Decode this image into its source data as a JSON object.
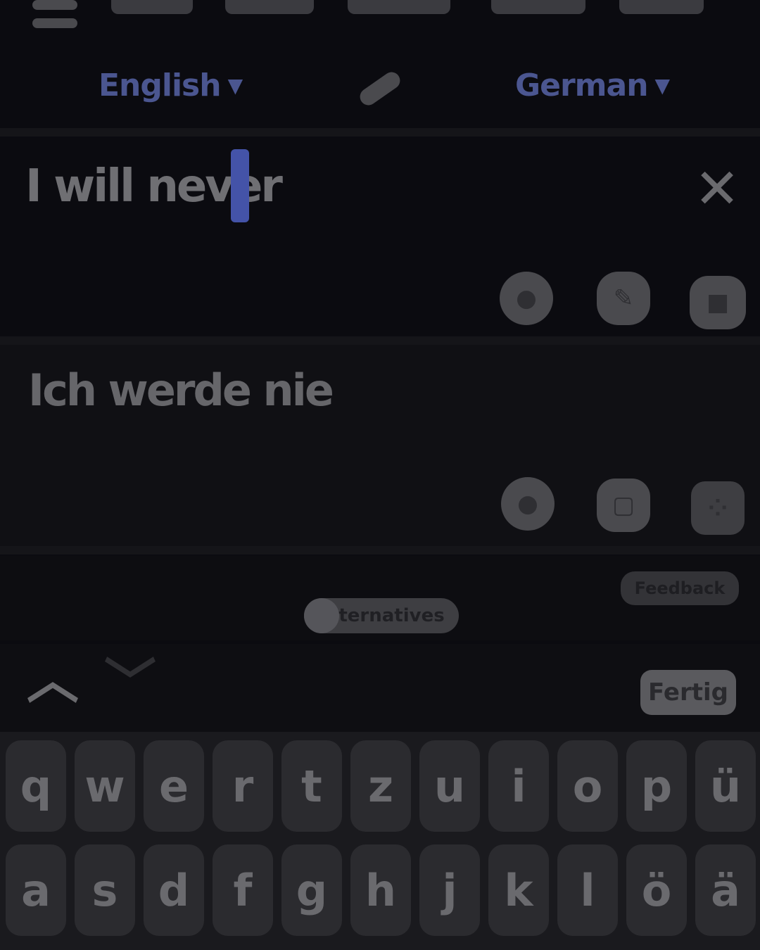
{
  "header": {
    "menu_icon": "hamburger-menu-icon"
  },
  "language_bar": {
    "source_language": "English",
    "target_language": "German",
    "caret_icon": "chevron-down-icon",
    "swap_icon": "swap-arrows-icon"
  },
  "source": {
    "text": "I will never",
    "clear_icon": "close-icon",
    "clear_glyph": "✕",
    "actions": [
      {
        "icon": "microphone-icon",
        "glyph": "●"
      },
      {
        "icon": "handwriting-icon",
        "glyph": "✎"
      },
      {
        "icon": "camera-icon",
        "glyph": "■"
      }
    ]
  },
  "result": {
    "text": "Ich werde nie",
    "actions": [
      {
        "icon": "speaker-icon",
        "glyph": "●"
      },
      {
        "icon": "copy-icon",
        "glyph": "▢"
      },
      {
        "icon": "more-options-icon",
        "glyph": "⁘"
      }
    ]
  },
  "alternatives": {
    "chip_label": "Alternatives",
    "top_right_label": "Feedback"
  },
  "keyboard_toolbar": {
    "up_icon": "chevron-up-icon",
    "up_glyph": "︿",
    "down_icon": "chevron-down-icon",
    "down_glyph": "﹀",
    "done_label": "Fertig"
  },
  "keyboard": {
    "row1": [
      "q",
      "w",
      "e",
      "r",
      "t",
      "z",
      "u",
      "i",
      "o",
      "p",
      "ü"
    ],
    "row2": [
      "a",
      "s",
      "d",
      "f",
      "g",
      "h",
      "j",
      "k",
      "l",
      "ö",
      "ä"
    ]
  },
  "colors": {
    "background": "#0b0b10",
    "accent": "#4453a8",
    "text_muted": "#6f6f73"
  }
}
